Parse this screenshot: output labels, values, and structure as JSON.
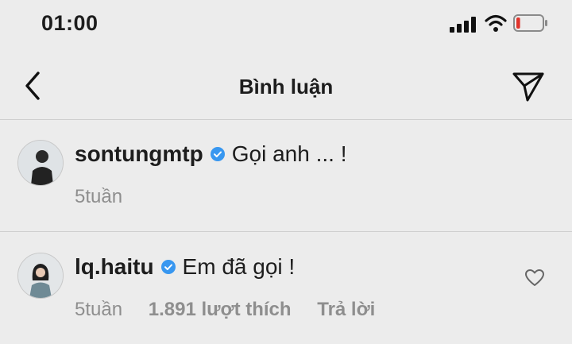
{
  "status_bar": {
    "time": "01:00",
    "signal_icon": "cellular-signal-icon",
    "wifi_icon": "wifi-icon",
    "battery_icon": "battery-low-icon",
    "battery_level": 0.15,
    "battery_color": "#e0342c"
  },
  "nav": {
    "title": "Bình luận",
    "back_icon": "chevron-left-icon",
    "send_icon": "paper-plane-icon"
  },
  "colors": {
    "verified": "#3897f0",
    "meta_text": "#8e8e8e",
    "background": "#ececec"
  },
  "caption": {
    "username": "sontungmtp",
    "verified": true,
    "text": "Gọi anh ... !",
    "time": "5tuần"
  },
  "comments": [
    {
      "username": "lq.haitu",
      "verified": true,
      "text": "Em đã gọi !",
      "time": "5tuần",
      "likes": "1.891 lượt thích",
      "reply_label": "Trả lời",
      "heart_icon": "heart-outline-icon"
    }
  ]
}
